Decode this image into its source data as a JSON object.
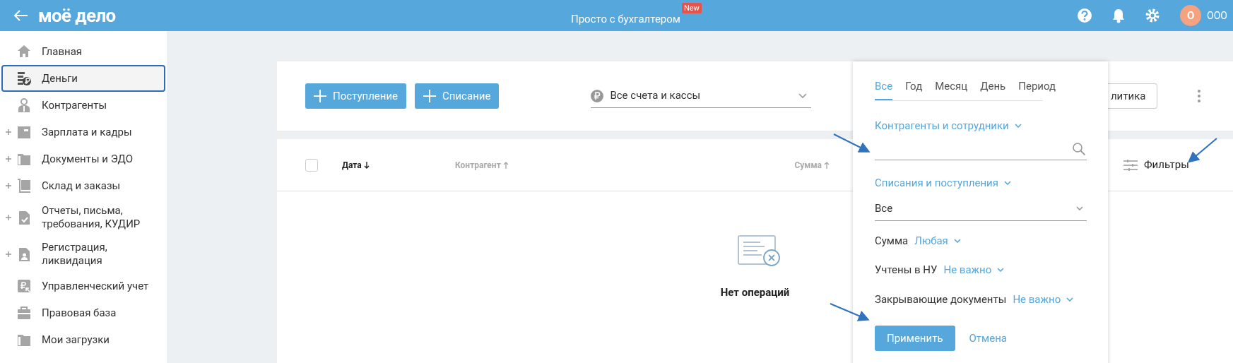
{
  "header": {
    "logo": "моё дело",
    "center_link": "Просто с бухгалтером",
    "badge": "New",
    "avatar": "О",
    "org": "ООО"
  },
  "sidebar": {
    "items": [
      {
        "label": "Главная",
        "selected": false,
        "expandable": false
      },
      {
        "label": "Деньги",
        "selected": true,
        "expandable": false
      },
      {
        "label": "Контрагенты",
        "selected": false,
        "expandable": false
      },
      {
        "label": "Зарплата и кадры",
        "selected": false,
        "expandable": true
      },
      {
        "label": "Документы и ЭДО",
        "selected": false,
        "expandable": true
      },
      {
        "label": "Склад и заказы",
        "selected": false,
        "expandable": true
      },
      {
        "label": "Отчеты, письма, требования, КУДИР",
        "selected": false,
        "expandable": true
      },
      {
        "label": "Регистрация, ликвидация",
        "selected": false,
        "expandable": true
      },
      {
        "label": "Управленческий учет",
        "selected": false,
        "expandable": false
      },
      {
        "label": "Правовая база",
        "selected": false,
        "expandable": false
      },
      {
        "label": "Мои загрузки",
        "selected": false,
        "expandable": false
      }
    ]
  },
  "toolbar": {
    "buttons": [
      "Поступление",
      "Списание"
    ],
    "account_select": "Все счета и кассы",
    "partial_button": "литика"
  },
  "table": {
    "select_all_checked": false,
    "columns": [
      {
        "label": "Дата",
        "descending": true,
        "active": true
      },
      {
        "label": "Контрагент",
        "descending": false,
        "active": false
      },
      {
        "label": "Сумма",
        "descending": false,
        "active": false
      }
    ],
    "filters_button": "Фильтры",
    "empty_text": "Нет операций"
  },
  "filter_panel": {
    "tabs": [
      {
        "label": "Все",
        "selected": true
      },
      {
        "label": "Год",
        "selected": false
      },
      {
        "label": "Месяц",
        "selected": false
      },
      {
        "label": "День",
        "selected": false
      },
      {
        "label": "Период",
        "selected": false
      }
    ],
    "counterparty_label": "Контрагенты и сотрудники",
    "operations_label": "Списания и поступления",
    "operations_value": "Все",
    "rows": [
      {
        "label": "Сумма",
        "value": "Любая"
      },
      {
        "label": "Учтены в НУ",
        "value": "Не важно"
      },
      {
        "label": "Закрывающие документы",
        "value": "Не важно"
      }
    ],
    "apply": "Применить",
    "cancel": "Отмена"
  }
}
